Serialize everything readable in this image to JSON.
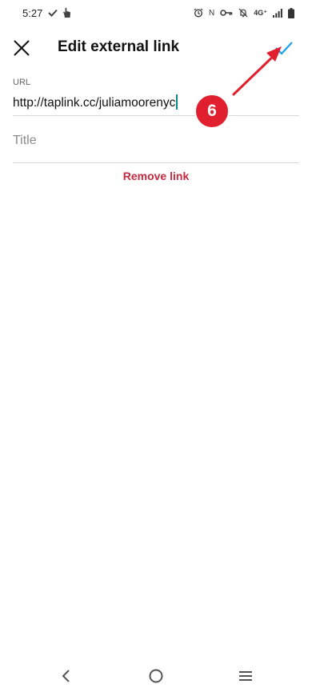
{
  "status_bar": {
    "time": "5:27",
    "left_icons": [
      "check-icon",
      "hand-icon"
    ],
    "right_icons": [
      "alarm-icon",
      "nfc-icon",
      "vpn-key-icon",
      "mute-icon",
      "network-icon",
      "signal-icon",
      "battery-icon"
    ],
    "nfc": "N",
    "network": "4G⁺"
  },
  "header": {
    "title": "Edit external link",
    "close_icon": "close-icon",
    "confirm_icon": "check-icon",
    "accent_color": "#1da1f2"
  },
  "form": {
    "url_label": "URL",
    "url_value": "http://taplink.cc/juliamoorenyc",
    "title_placeholder": "Title",
    "title_value": ""
  },
  "actions": {
    "remove_label": "Remove link",
    "remove_color": "#c9283e"
  },
  "annotation": {
    "step_number": "6",
    "color": "#e0202e"
  },
  "nav_bar": {
    "buttons": [
      "back-icon",
      "home-icon",
      "menu-icon"
    ]
  }
}
